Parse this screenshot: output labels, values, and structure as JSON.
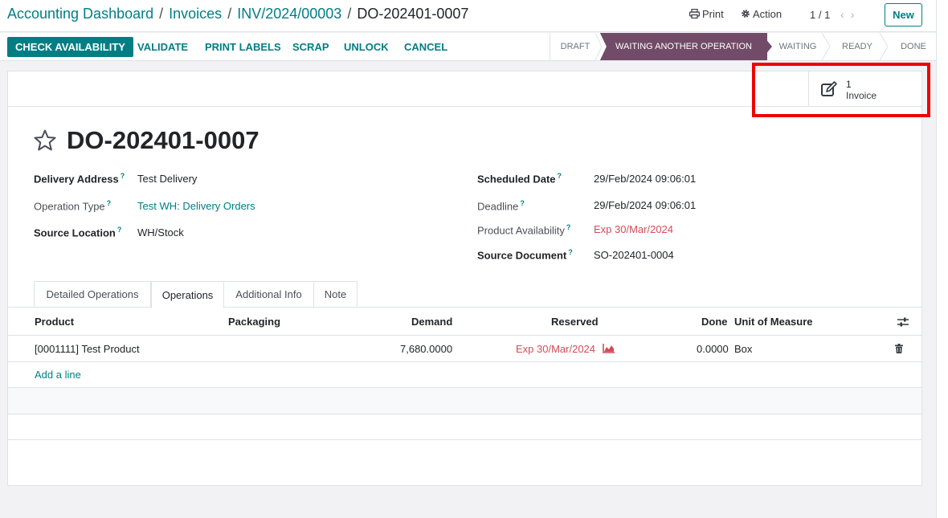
{
  "breadcrumb": {
    "items": [
      "Accounting Dashboard",
      "Invoices",
      "INV/2024/00003"
    ],
    "current": "DO-202401-0007"
  },
  "header": {
    "print_label": "Print",
    "action_label": "Action",
    "pager": "1 / 1",
    "new_label": "New"
  },
  "actions": {
    "check_availability": "CHECK AVAILABILITY",
    "validate": "VALIDATE",
    "print_labels": "PRINT LABELS",
    "scrap": "SCRAP",
    "unlock": "UNLOCK",
    "cancel": "CANCEL"
  },
  "statusbar": {
    "stages": [
      "DRAFT",
      "WAITING ANOTHER OPERATION",
      "WAITING",
      "READY",
      "DONE"
    ],
    "active": "WAITING ANOTHER OPERATION",
    "active_color": "#714b67"
  },
  "smart_button": {
    "count": "1",
    "label": "Invoice",
    "icon": "edit-icon"
  },
  "record": {
    "title": "DO-202401-0007"
  },
  "fields_left": {
    "delivery_address_label": "Delivery Address",
    "delivery_address": "Test Delivery",
    "operation_type_label": "Operation Type",
    "operation_type": "Test WH: Delivery Orders",
    "source_location_label": "Source Location",
    "source_location": "WH/Stock"
  },
  "fields_right": {
    "scheduled_date_label": "Scheduled Date",
    "scheduled_date": "29/Feb/2024 09:06:01",
    "deadline_label": "Deadline",
    "deadline": "29/Feb/2024 09:06:01",
    "availability_label": "Product Availability",
    "availability": "Exp 30/Mar/2024",
    "source_document_label": "Source Document",
    "source_document": "SO-202401-0004"
  },
  "tabs": [
    "Detailed Operations",
    "Operations",
    "Additional Info",
    "Note"
  ],
  "active_tab": "Operations",
  "table": {
    "headers": [
      "Product",
      "Packaging",
      "Demand",
      "Reserved",
      "Done",
      "Unit of Measure"
    ],
    "rows": [
      {
        "product": "[0001111] Test Product",
        "packaging": "",
        "demand": "7,680.0000",
        "reserved": "Exp 30/Mar/2024",
        "done": "0.0000",
        "uom": "Box"
      }
    ],
    "add_line": "Add a line"
  },
  "colors": {
    "primary": "#017e84",
    "accent": "#714b67",
    "danger": "#d44c59",
    "highlight": "#f00000"
  }
}
